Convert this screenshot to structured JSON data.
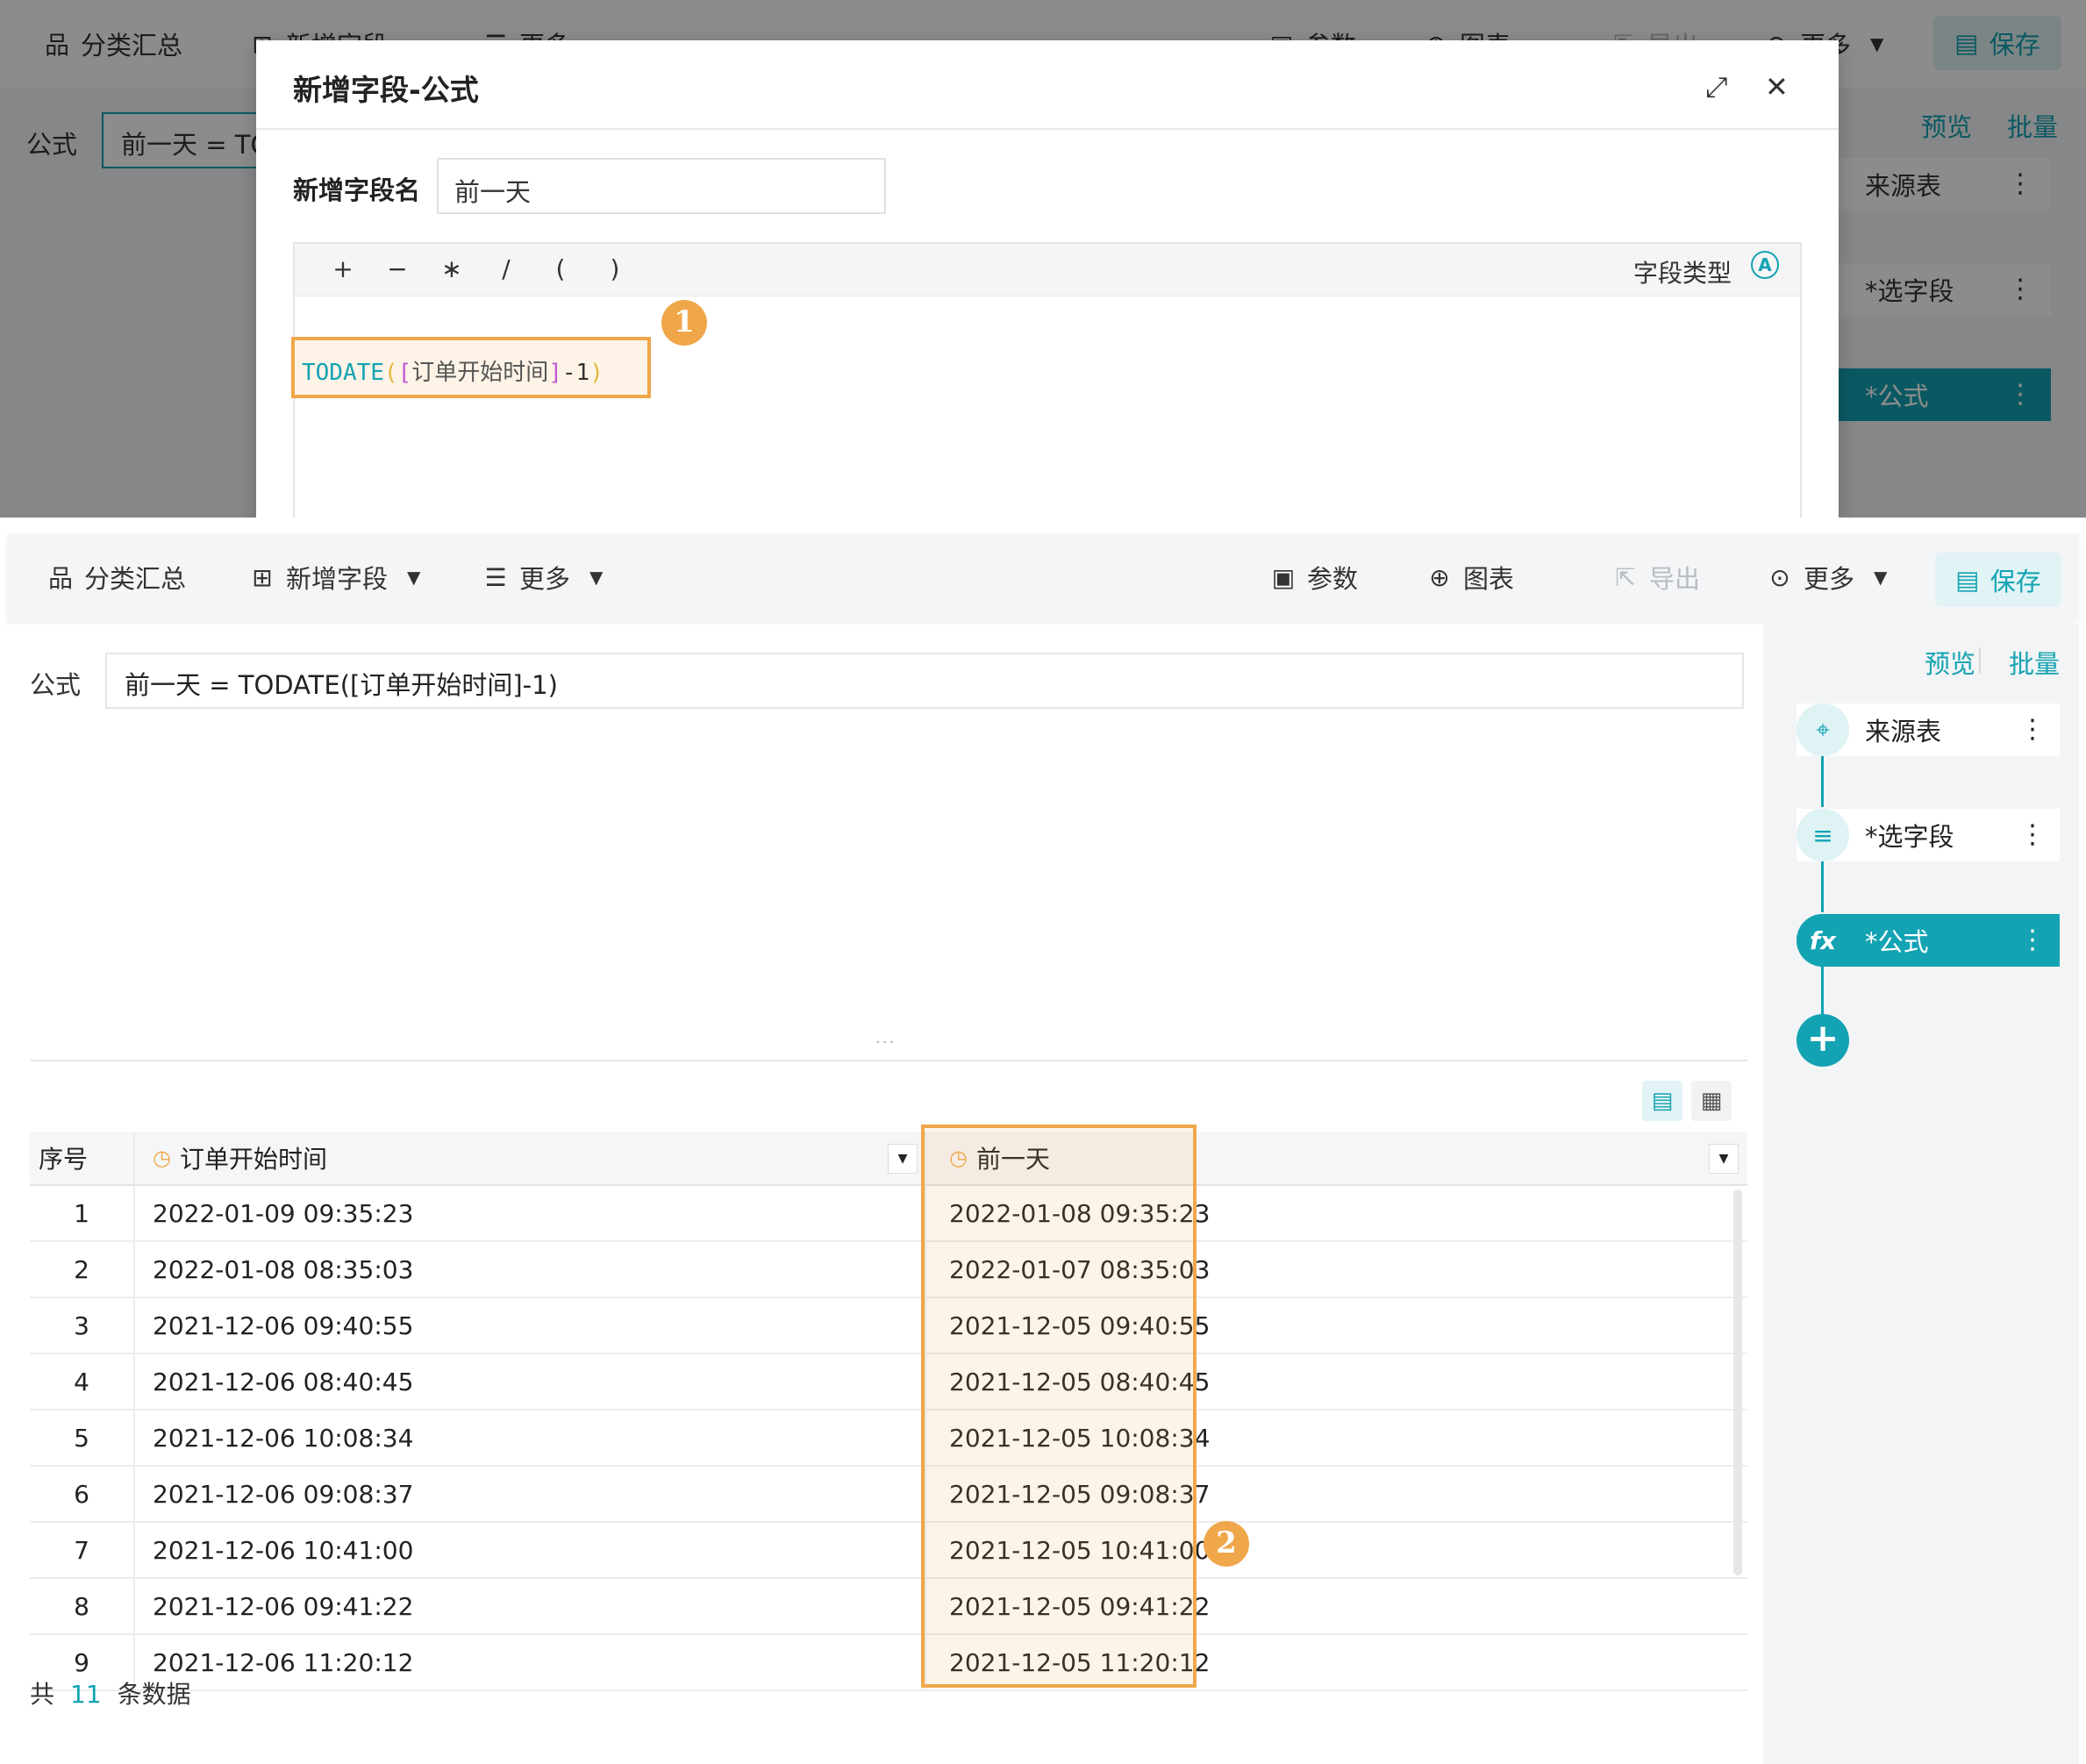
{
  "toolbar": {
    "summary": "分类汇总",
    "add_field": "新增字段",
    "more_left": "更多",
    "params": "参数",
    "chart": "图表",
    "export": "导出",
    "more_right": "更多",
    "save": "保存"
  },
  "formula_bar": {
    "label": "公式",
    "value": "前一天 = TODATE([订单开始时间]-1)",
    "top_value": "前一天 = TO"
  },
  "side_panel": {
    "preview": "预览",
    "batch": "批量",
    "nodes": [
      {
        "label": "来源表",
        "icon": "crosshair-icon"
      },
      {
        "label": "*选字段",
        "icon": "select-fields-icon"
      },
      {
        "label": "*公式",
        "icon": "fx-icon"
      }
    ],
    "add_icon": "plus-icon"
  },
  "modal": {
    "title": "新增字段-公式",
    "field_name_label": "新增字段名",
    "field_name_value": "前一天",
    "operators": [
      "+",
      "−",
      "∗",
      "/",
      "(",
      ")"
    ],
    "field_type_label": "字段类型",
    "field_type_icon": "A",
    "code": {
      "fn": "TODATE",
      "open_paren": "(",
      "open_br": "[",
      "field": "订单开始时间",
      "close_br": "]",
      "op": "-1",
      "close_paren": ")"
    },
    "badge": "1"
  },
  "table": {
    "columns": [
      "序号",
      "订单开始时间",
      "前一天"
    ],
    "rows": [
      [
        "1",
        "2022-01-09 09:35:23",
        "2022-01-08 09:35:23"
      ],
      [
        "2",
        "2022-01-08 08:35:03",
        "2022-01-07 08:35:03"
      ],
      [
        "3",
        "2021-12-06 09:40:55",
        "2021-12-05 09:40:55"
      ],
      [
        "4",
        "2021-12-06 08:40:45",
        "2021-12-05 08:40:45"
      ],
      [
        "5",
        "2021-12-06 10:08:34",
        "2021-12-05 10:08:34"
      ],
      [
        "6",
        "2021-12-06 09:08:37",
        "2021-12-05 09:08:37"
      ],
      [
        "7",
        "2021-12-06 10:41:00",
        "2021-12-05 10:41:00"
      ],
      [
        "8",
        "2021-12-06 09:41:22",
        "2021-12-05 09:41:22"
      ],
      [
        "9",
        "2021-12-06 11:20:12",
        "2021-12-05 11:20:12"
      ]
    ],
    "badge": "2"
  },
  "footer": {
    "prefix": "共",
    "count": "11",
    "suffix": "条数据"
  },
  "colors": {
    "accent": "#13a3b3",
    "highlight": "#f0a74a"
  }
}
